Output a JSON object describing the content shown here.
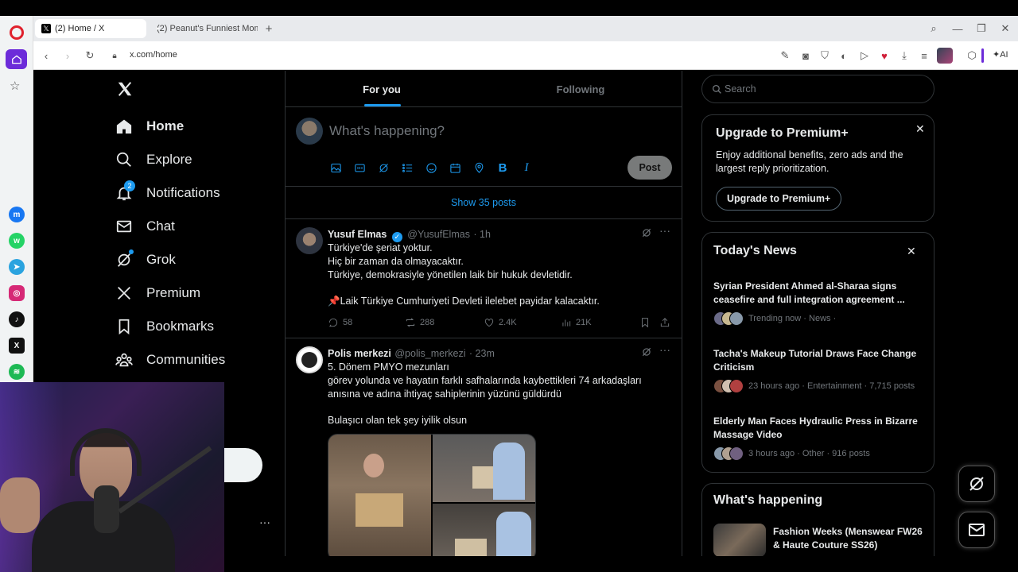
{
  "browser": {
    "tabs": [
      {
        "title": "(2) Home / X",
        "active": true
      },
      {
        "title": "(2) Peanut's Funniest Mom",
        "active": false
      }
    ],
    "url": "x.com/home",
    "ai_label": "AI"
  },
  "nav": {
    "items": [
      {
        "label": "Home",
        "icon": "home-icon"
      },
      {
        "label": "Explore",
        "icon": "search-icon"
      },
      {
        "label": "Notifications",
        "icon": "bell-icon",
        "badge": "2"
      },
      {
        "label": "Chat",
        "icon": "mail-icon"
      },
      {
        "label": "Grok",
        "icon": "grok-icon"
      },
      {
        "label": "Premium",
        "icon": "x-logo-icon"
      },
      {
        "label": "Bookmarks",
        "icon": "bookmark-icon"
      },
      {
        "label": "Communities",
        "icon": "communities-icon"
      }
    ],
    "more": "···"
  },
  "timeline": {
    "tabs": [
      "For you",
      "Following"
    ],
    "composer_placeholder": "What's happening?",
    "post_button": "Post",
    "show_posts": "Show 35 posts",
    "tweets": [
      {
        "name": "Yusuf Elmas",
        "handle": "@YusufElmas",
        "time": "· 1h",
        "lines": [
          "Türkiye'de şeriat yoktur.",
          "Hiç bir zaman da olmayacaktır.",
          "Türkiye, demokrasiyle yönetilen laik bir hukuk devletidir.",
          "",
          "📌Laik Türkiye Cumhuriyeti Devleti ilelebet payidar kalacaktır."
        ],
        "replies": "58",
        "reposts": "288",
        "likes": "2.4K",
        "views": "21K"
      },
      {
        "name": "Polis merkezi",
        "handle": "@polis_merkezi",
        "time": "· 23m",
        "lines": [
          "5. Dönem PMYO mezunları",
          "görev yolunda ve hayatın farklı safhalarında kaybettikleri 74 arkadaşları",
          "anısına ve adına ihtiyaç sahiplerinin yüzünü güldürdü",
          "",
          "Bulaşıcı olan tek şey iyilik olsun"
        ]
      }
    ]
  },
  "sidebar": {
    "search_placeholder": "Search",
    "premium": {
      "title": "Upgrade to Premium+",
      "body": "Enjoy additional benefits, zero ads and the largest reply prioritization.",
      "button": "Upgrade to Premium+"
    },
    "news": {
      "title": "Today's News",
      "items": [
        {
          "headline": "Syrian President Ahmed al-Sharaa signs ceasefire and full integration agreement ...",
          "meta": "Trending now · News ·"
        },
        {
          "headline": "Tacha's Makeup Tutorial Draws Face Change Criticism",
          "meta": "23 hours ago · Entertainment · 7,715 posts"
        },
        {
          "headline": "Elderly Man Faces Hydraulic Press in Bizarre Massage Video",
          "meta": "3 hours ago · Other · 916 posts"
        }
      ]
    },
    "happening": {
      "title": "What's happening",
      "items": [
        {
          "headline": "Fashion Weeks (Menswear FW26 & Haute Couture SS26)"
        }
      ]
    }
  },
  "colors": {
    "accent": "#1d9bf0",
    "background": "#000000",
    "border": "#2f3336",
    "muted": "#71767b"
  }
}
